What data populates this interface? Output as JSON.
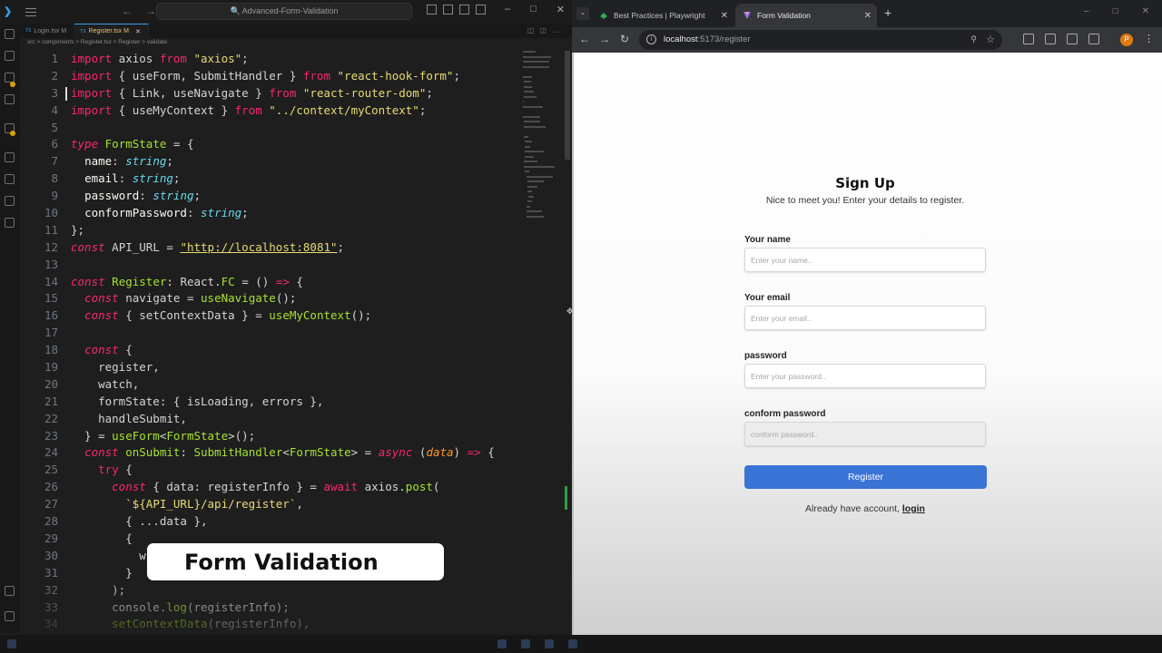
{
  "editor": {
    "title": "Advanced-Form-Validation",
    "tabs": [
      {
        "label": "Login.tsx M",
        "active": false
      },
      {
        "label": "Register.tsx M",
        "active": true
      }
    ],
    "breadcrumb": "src > components > Register.tsx > Register > validate",
    "code_lines": [
      "<span class='k'>import</span> axios <span class='k'>from</span> <span class='s'>\"axios\"</span>;",
      "<span class='k'>import</span> { useForm, SubmitHandler } <span class='k'>from</span> <span class='s'>\"react-hook-form\"</span>;",
      "<span class='k'>import</span> { Link, useNavigate } <span class='k'>from</span> <span class='s'>\"react-router-dom\"</span>;",
      "<span class='k'>import</span> { useMyContext } <span class='k'>from</span> <span class='s'>\"../context/myContext\"</span>;",
      "",
      "<span class='kf'>type</span> <span class='f'>FormState</span> = {",
      "  <span class='c'>name</span>: <span class='t'>string</span>;",
      "  <span class='c'>email</span>: <span class='t'>string</span>;",
      "  <span class='c'>password</span>: <span class='t'>string</span>;",
      "  <span class='c'>conformPassword</span>: <span class='t'>string</span>;",
      "};",
      "<span class='kf'>const</span> API_URL = <span class='u'>\"http://localhost:8081\"</span>;",
      "",
      "<span class='kf'>const</span> <span class='f'>Register</span>: React.<span class='f'>FC</span> = () <span class='k'>=></span> {",
      "  <span class='kf'>const</span> navigate = <span class='f'>useNavigate</span>();",
      "  <span class='kf'>const</span> { setContextData } = <span class='f'>useMyContext</span>();",
      "",
      "  <span class='kf'>const</span> {",
      "    register,",
      "    watch,",
      "    formState: { isLoading, errors },",
      "    handleSubmit,",
      "  } = <span class='f'>useForm</span><<span class='f'>FormState</span>>();",
      "  <span class='kf'>const</span> <span class='f'>onSubmit</span>: <span class='f'>SubmitHandler</span><<span class='f'>FormState</span>> = <span class='kf'>async</span> (<span class='v'>data</span>) <span class='k'>=></span> {",
      "    <span class='k'>try</span> {",
      "      <span class='kf'>const</span> { data: registerInfo } = <span class='k'>await</span> axios.<span class='f'>post</span>(",
      "        <span class='s'>`${API_URL}/api/register`</span>,",
      "        { ...data },",
      "        {",
      "          w",
      "        }",
      "      );",
      "      console.<span class='f'>log</span>(registerInfo);",
      "      <span class='f'>setContextData</span>(registerInfo),"
    ]
  },
  "overlay_caption": "Form Validation",
  "browser": {
    "tabs": [
      {
        "label": "Best Practices | Playwright",
        "active": false
      },
      {
        "label": "Form Validation",
        "active": true
      }
    ],
    "url_host": "localhost",
    "url_rest": ":5173/register",
    "profile_initial": "P"
  },
  "signup": {
    "title": "Sign Up",
    "subtitle": "Nice to meet you! Enter your details to register.",
    "fields": [
      {
        "label": "Your name",
        "placeholder": "Enter your name.."
      },
      {
        "label": "Your email",
        "placeholder": "Enter your email.."
      },
      {
        "label": "password",
        "placeholder": "Enter your password.."
      },
      {
        "label": "conform password",
        "placeholder": "conform password.."
      }
    ],
    "submit_label": "Register",
    "footer_text": "Already have account,",
    "footer_link": "login"
  },
  "colors": {
    "accent_button": "#3a73d6",
    "editor_bg": "#1e1e1e",
    "browser_chrome": "#202124"
  }
}
